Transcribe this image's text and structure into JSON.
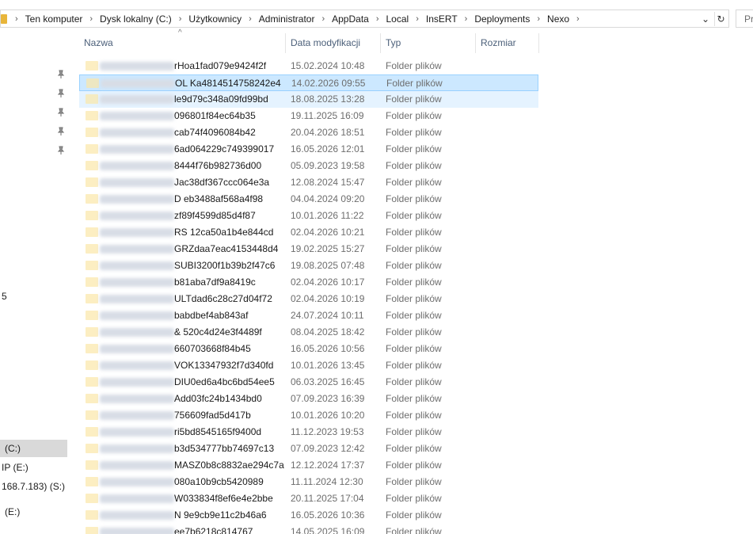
{
  "address_bar": {
    "crumbs": [
      "Ten komputer",
      "Dysk lokalny (C:)",
      "Użytkownicy",
      "Administrator",
      "AppData",
      "Local",
      "InsERT",
      "Deployments",
      "Nexo"
    ],
    "separator": "›",
    "dropdown_glyph": "⌄",
    "refresh_glyph": "↻"
  },
  "search": {
    "placeholder": "Pr"
  },
  "nav": {
    "items": [
      "5",
      "(C:)",
      "IP (E:)",
      "168.7.183) (S:)",
      "(E:)"
    ]
  },
  "columns": {
    "name": "Nazwa",
    "date": "Data modyfikacji",
    "type": "Typ",
    "size": "Rozmiar",
    "sort_glyph": "^"
  },
  "colors": {
    "selected_row": "#cce8ff",
    "hover_row": "#e5f3ff",
    "header_text": "#4c607a",
    "folder_icon": "#e8b53a"
  },
  "rows": [
    {
      "name": "rHoa1fad079e9424f2f",
      "date": "15.02.2024 10:48",
      "type": "Folder plików"
    },
    {
      "name": "OL Ka4814514758242e4",
      "date": "14.02.2026 09:55",
      "type": "Folder plików"
    },
    {
      "name": "le9d79c348a09fd99bd",
      "date": "18.08.2025 13:28",
      "type": "Folder plików"
    },
    {
      "name": "096801f84ec64b35",
      "date": "19.11.2025 16:09",
      "type": "Folder plików"
    },
    {
      "name": "cab74f4096084b42",
      "date": "20.04.2026 18:51",
      "type": "Folder plików"
    },
    {
      "name": "6ad064229c749399017",
      "date": "16.05.2026 12:01",
      "type": "Folder plików"
    },
    {
      "name": "8444f76b982736d00",
      "date": "05.09.2023 19:58",
      "type": "Folder plików"
    },
    {
      "name": "Jac38df367ccc064e3a",
      "date": "12.08.2024 15:47",
      "type": "Folder plików"
    },
    {
      "name": "D eb3488af568a4f98",
      "date": "04.04.2024 09:20",
      "type": "Folder plików"
    },
    {
      "name": "zf89f4599d85d4f87",
      "date": "10.01.2026 11:22",
      "type": "Folder plików"
    },
    {
      "name": "RS 12ca50a1b4e844cd",
      "date": "02.04.2026 10:21",
      "type": "Folder plików"
    },
    {
      "name": "GRZdaa7eac4153448d4",
      "date": "19.02.2025 15:27",
      "type": "Folder plików"
    },
    {
      "name": "SUBI3200f1b39b2f47c6",
      "date": "19.08.2025 07:48",
      "type": "Folder plików"
    },
    {
      "name": "b81aba7df9a8419c",
      "date": "02.04.2026 10:17",
      "type": "Folder plików"
    },
    {
      "name": "ULTdad6c28c27d04f72",
      "date": "02.04.2026 10:19",
      "type": "Folder plików"
    },
    {
      "name": "babdbef4ab843af",
      "date": "24.07.2024 10:11",
      "type": "Folder plików"
    },
    {
      "name": "& 520c4d24e3f4489f",
      "date": "08.04.2025 18:42",
      "type": "Folder plików"
    },
    {
      "name": "660703668f84b45",
      "date": "16.05.2026 10:56",
      "type": "Folder plików"
    },
    {
      "name": "VOK13347932f7d340fd",
      "date": "10.01.2026 13:45",
      "type": "Folder plików"
    },
    {
      "name": "DIU0ed6a4bc6bd54ee5",
      "date": "06.03.2025 16:45",
      "type": "Folder plików"
    },
    {
      "name": "Add03fc24b1434bd0",
      "date": "07.09.2023 16:39",
      "type": "Folder plików"
    },
    {
      "name": "756609fad5d417b",
      "date": "10.01.2026 10:20",
      "type": "Folder plików"
    },
    {
      "name": "ri5bd8545165f9400d",
      "date": "11.12.2023 19:53",
      "type": "Folder plików"
    },
    {
      "name": "b3d534777bb74697c13",
      "date": "07.09.2023 12:42",
      "type": "Folder plików"
    },
    {
      "name": "MASZ0b8c8832ae294c7a",
      "date": "12.12.2024 17:37",
      "type": "Folder plików"
    },
    {
      "name": "080a10b9cb5420989",
      "date": "11.11.2024 12:30",
      "type": "Folder plików"
    },
    {
      "name": "W033834f8ef6e4e2bbe",
      "date": "20.11.2025 17:04",
      "type": "Folder plików"
    },
    {
      "name": "N 9e9cb9e11c2b46a6",
      "date": "16.05.2026 10:36",
      "type": "Folder plików"
    },
    {
      "name": "ee7b6218c814767",
      "date": "14.05.2025 16:09",
      "type": "Folder plików"
    }
  ]
}
